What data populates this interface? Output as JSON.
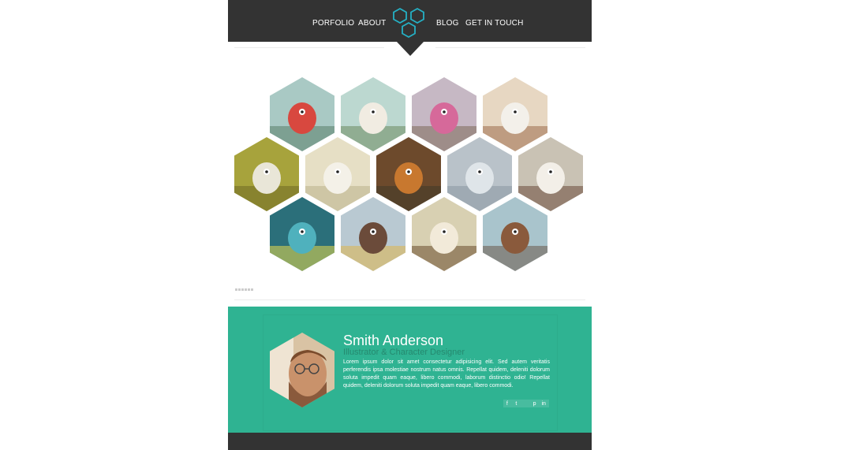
{
  "nav": {
    "portfolio": "PORFOLIO",
    "about": "ABOUT",
    "blog": "BLOG",
    "contact": "GET IN TOUCH"
  },
  "logo": {
    "icon": "hexagon-cluster-logo",
    "color": "#25b0c4"
  },
  "gallery": {
    "items": [
      {
        "subject": "red horned monster"
      },
      {
        "subject": "white sheep creature"
      },
      {
        "subject": "pink many-eyed monster"
      },
      {
        "subject": "white creature with birds"
      },
      {
        "subject": "lizard creature on grass"
      },
      {
        "subject": "white antlered creature"
      },
      {
        "subject": "snail and spiky creatures"
      },
      {
        "subject": "two furry monsters"
      },
      {
        "subject": "hooded yeti"
      },
      {
        "subject": "jellyfish"
      },
      {
        "subject": "tribal mask monster"
      },
      {
        "subject": "bird and beetle"
      },
      {
        "subject": "horned creature on hill"
      }
    ]
  },
  "profile": {
    "name": "Smith Anderson",
    "role": "Illustrator & Character Designer",
    "bio": "Lorem ipsum dolor sit amet consectetur adipisicing elit. Sed autem veritatis perferendis ipsa molestiae nostrum natus omnis. Repellat quidem, deleniti dolorum soluta impedit quam eaque, libero commodi, laborum distinctio odio! Repellat quidem, deleniti dolorum soluta impedit quam eaque, libero commodi.",
    "social": [
      {
        "icon": "facebook-icon",
        "glyph": "f"
      },
      {
        "icon": "twitter-icon",
        "glyph": "t"
      },
      {
        "icon": "blank-icon",
        "glyph": ""
      },
      {
        "icon": "pinterest-icon",
        "glyph": "p"
      },
      {
        "icon": "linkedin-icon",
        "glyph": "in"
      }
    ]
  },
  "colors": {
    "header": "#333333",
    "accent": "#2fb392",
    "role_text": "#25896f"
  }
}
